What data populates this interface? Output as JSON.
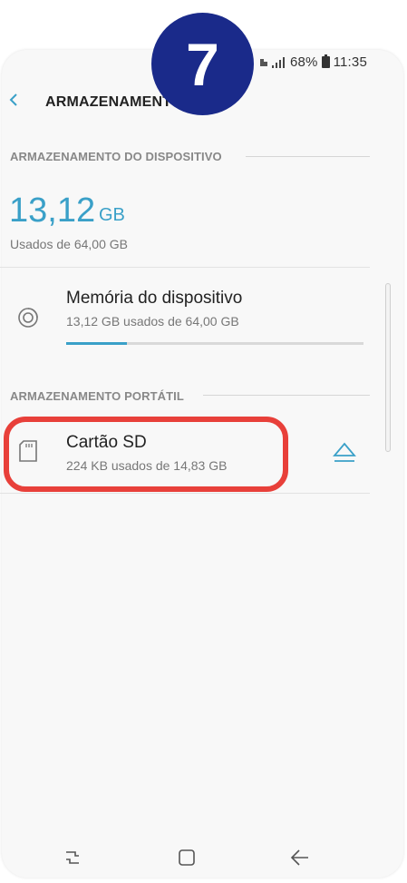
{
  "status_bar": {
    "battery": "68%",
    "time": "11:35"
  },
  "step_badge": "7",
  "header": {
    "title": "ARMAZENAMENTO"
  },
  "device_section": {
    "header": "ARMAZENAMENTO DO DISPOSITIVO",
    "used_value": "13,12",
    "used_unit": "GB",
    "used_of": "Usados de 64,00 GB"
  },
  "device_memory": {
    "title": "Memória do dispositivo",
    "subtitle": "13,12 GB usados de 64,00 GB",
    "fill_fraction": 0.205
  },
  "portable_section": {
    "header": "ARMAZENAMENTO PORTÁTIL"
  },
  "sd_card": {
    "title": "Cartão SD",
    "subtitle": "224 KB usados de 14,83 GB"
  },
  "colors": {
    "accent": "#3aa0c8",
    "highlight": "#e8403a",
    "badge": "#1a2a8a"
  },
  "icons": {
    "back": "back-arrow-icon",
    "device_memory": "storage-circle-icon",
    "sd_card": "sd-card-icon",
    "eject": "eject-icon",
    "nav_recents": "recents-icon",
    "nav_home": "home-icon",
    "nav_back": "nav-back-icon"
  }
}
